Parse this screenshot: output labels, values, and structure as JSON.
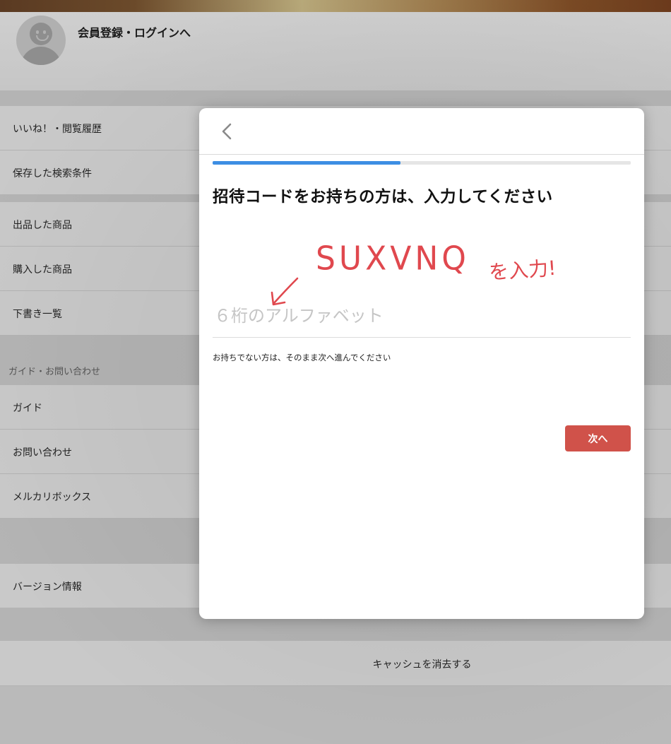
{
  "header": {
    "title": "会員登録・ログインへ",
    "avatar_icon": "user-avatar-icon"
  },
  "menu": {
    "group1": [
      "いいね！・閲覧履歴",
      "保存した検索条件"
    ],
    "group2": [
      "出品した商品",
      "購入した商品",
      "下書き一覧"
    ],
    "guide_section_label": "ガイド・お問い合わせ",
    "group3": [
      "ガイド",
      "お問い合わせ",
      "メルカリボックス"
    ],
    "group4": [
      "バージョン情報"
    ],
    "clear_cache": "キャッシュを消去する"
  },
  "modal": {
    "back_icon": "chevron-left-icon",
    "progress": 0.45,
    "title": "招待コードをお持ちの方は、入力してください",
    "input_placeholder": "６桁のアルファベット",
    "input_value": "",
    "hint": "お持ちでない方は、そのまま次へ進んでください",
    "next_label": "次へ"
  },
  "annotation": {
    "code": "SUXVNQ",
    "note": "を入力!",
    "color": "#e0484e"
  },
  "colors": {
    "accent_blue": "#3d8ee3",
    "button_red": "#d0524a"
  }
}
